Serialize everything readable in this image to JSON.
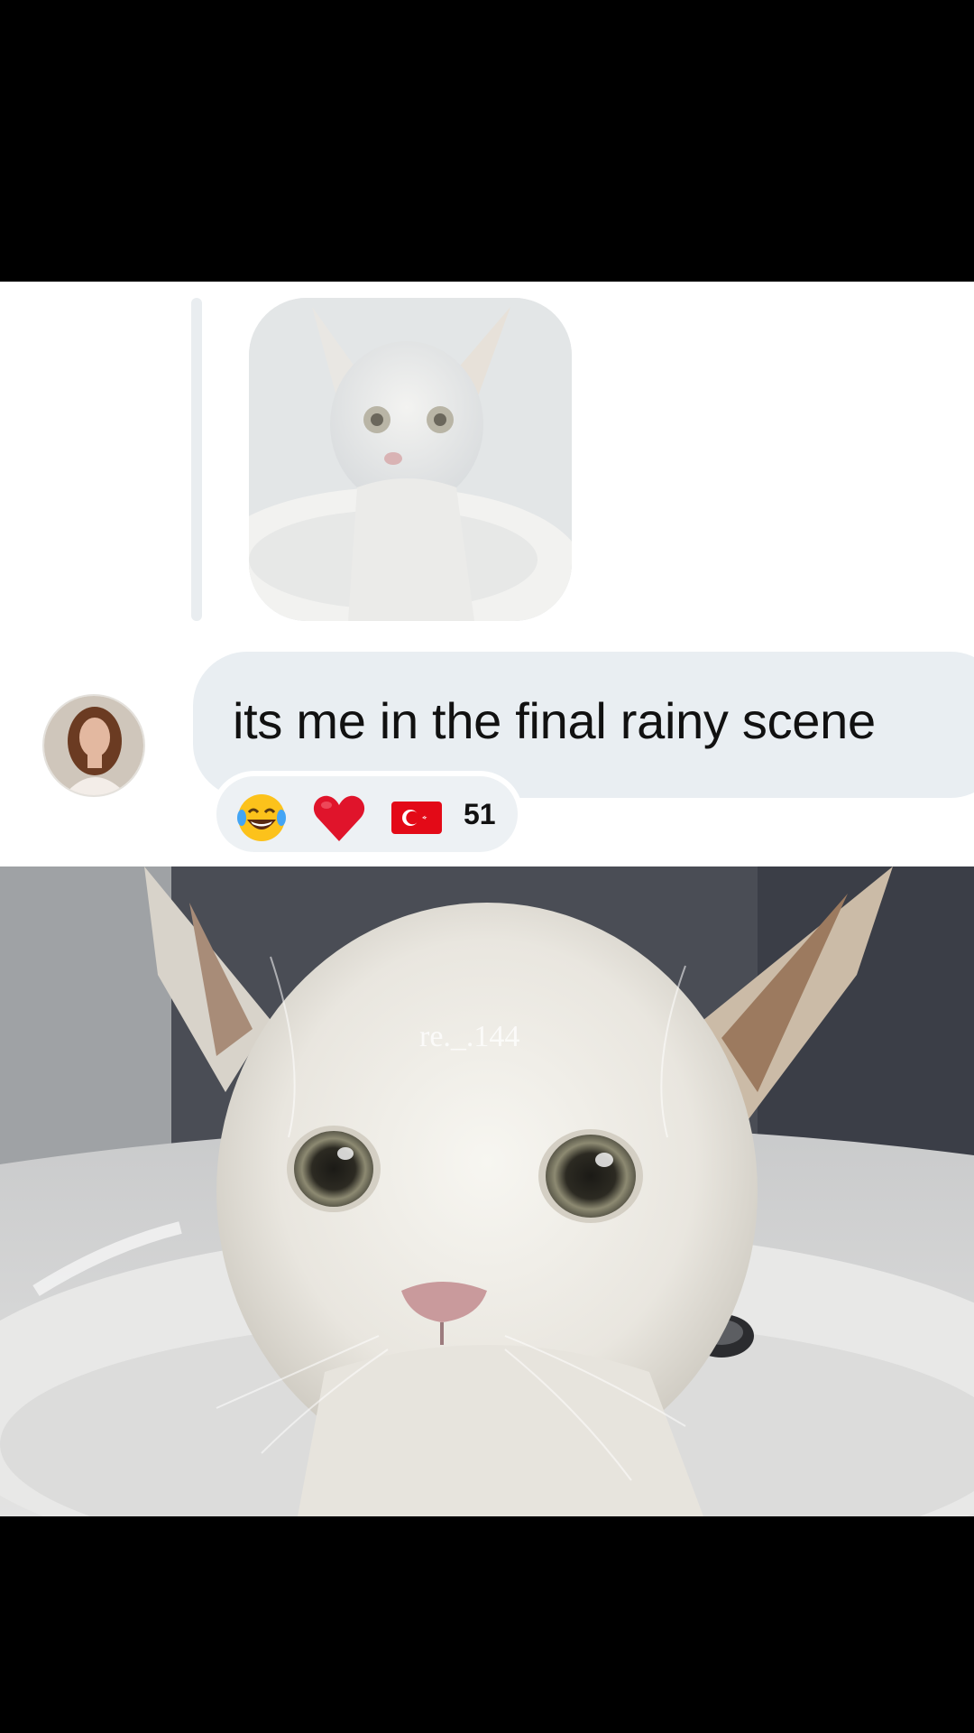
{
  "message": {
    "text": "its me in the final rainy scene"
  },
  "reactions": {
    "items": [
      {
        "icon": "laughing-tears-emoji-icon"
      },
      {
        "icon": "red-heart-emoji-icon"
      },
      {
        "icon": "turkey-flag-icon"
      }
    ],
    "count": "51"
  },
  "watermark": "re._.144",
  "colors": {
    "bubble": "#e9eef2",
    "heart": "#e0142b",
    "flag": "#e30a17"
  }
}
